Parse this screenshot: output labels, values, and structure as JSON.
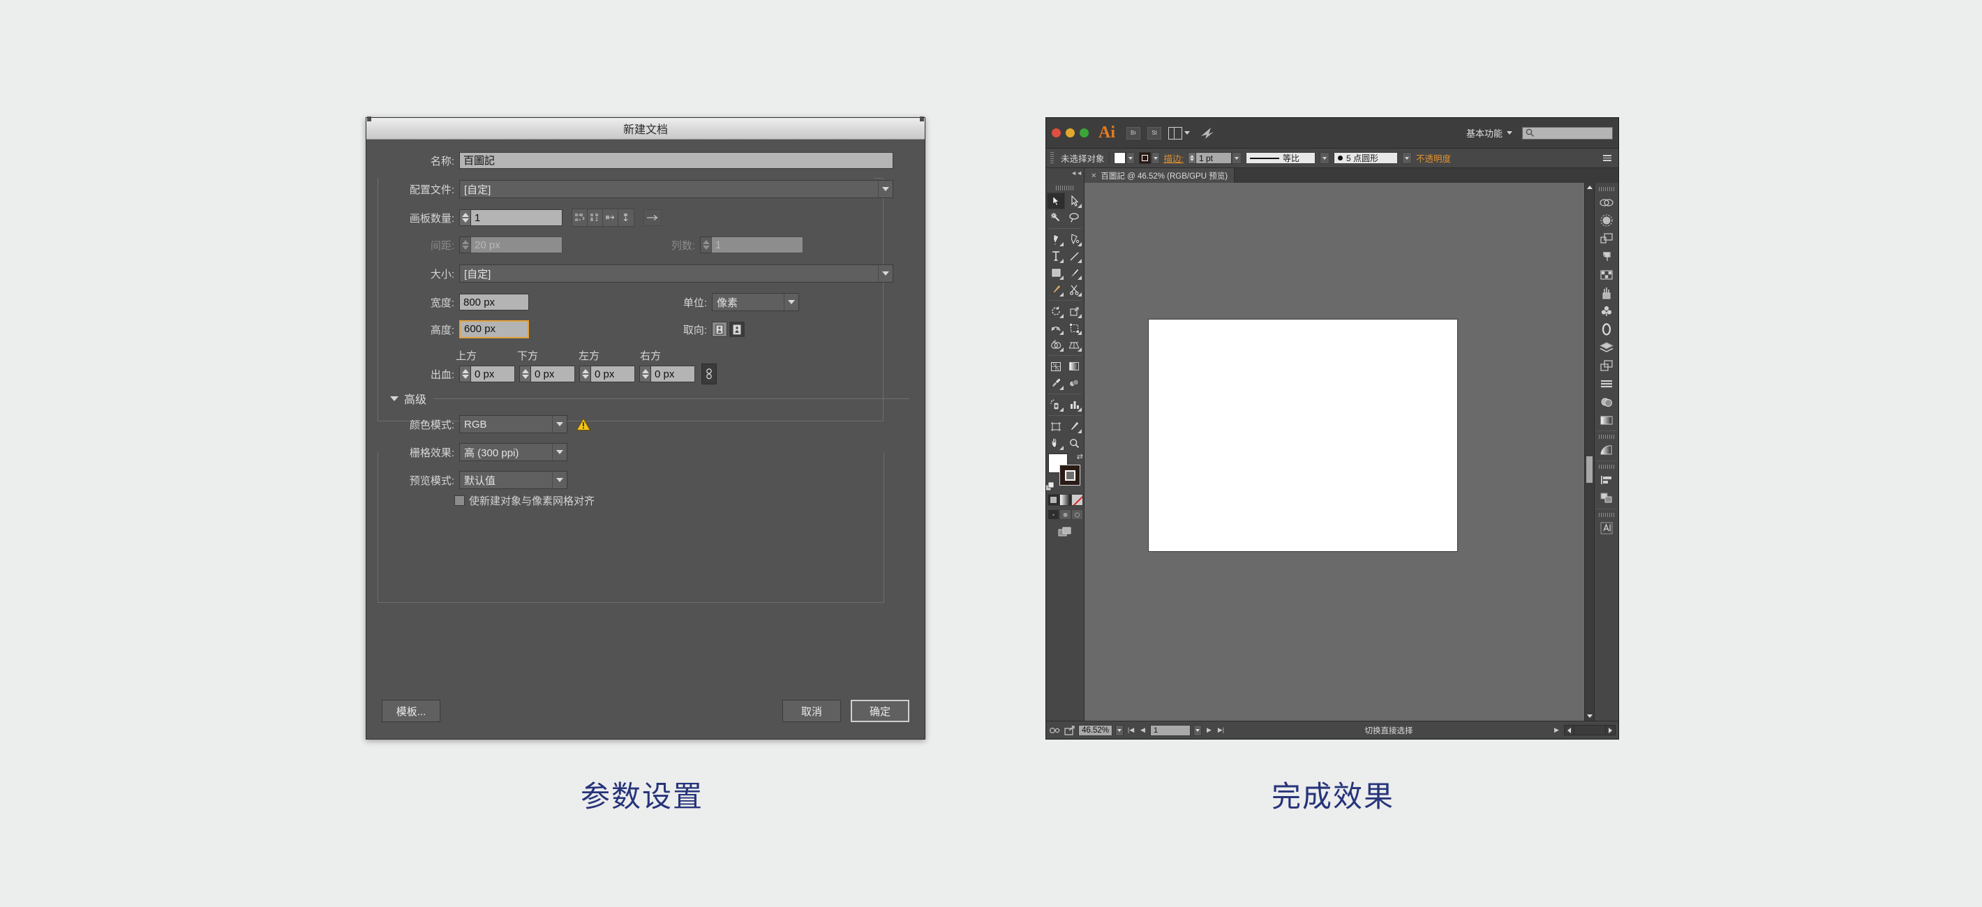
{
  "captions": {
    "left": "参数设置",
    "right": "完成效果",
    "color": "#26347a"
  },
  "dialog": {
    "title": "新建文档",
    "fields": {
      "name_label": "名称:",
      "name_value": "百圖記",
      "profile_label": "配置文件:",
      "profile_value": "[自定]",
      "artboards_label": "画板数量:",
      "artboards_value": "1",
      "spacing_label": "间距:",
      "spacing_value": "20 px",
      "columns_label": "列数:",
      "columns_value": "1",
      "size_label": "大小:",
      "size_value": "[自定]",
      "width_label": "宽度:",
      "width_value": "800 px",
      "units_label": "单位:",
      "units_value": "像素",
      "height_label": "高度:",
      "height_value": "600 px",
      "orientation_label": "取向:",
      "bleed_label": "出血:",
      "bleed_top_header": "上方",
      "bleed_bottom_header": "下方",
      "bleed_left_header": "左方",
      "bleed_right_header": "右方",
      "bleed_top": "0 px",
      "bleed_bottom": "0 px",
      "bleed_left": "0 px",
      "bleed_right": "0 px"
    },
    "advanced": {
      "section_label": "高级",
      "color_mode_label": "颜色模式:",
      "color_mode_value": "RGB",
      "raster_label": "栅格效果:",
      "raster_value": "高 (300 ppi)",
      "preview_label": "预览模式:",
      "preview_value": "默认值",
      "align_pixel_label": "使新建对象与像素网格对齐",
      "align_pixel_checked": false
    },
    "buttons": {
      "templates": "模板...",
      "cancel": "取消",
      "ok": "确定"
    },
    "focus_field": "height",
    "focus_color": "#e2a13c"
  },
  "illustrator": {
    "app_bar": {
      "logo": "Ai",
      "bridge_label": "Br",
      "stock_label": "St",
      "workspace": "基本功能",
      "search_placeholder": ""
    },
    "control_bar": {
      "selection_status": "未选择对象",
      "stroke_label": "描边:",
      "stroke_weight": "1 pt",
      "profile_value": "等比",
      "brush_value": "5 点圆形",
      "opacity_label": "不透明度",
      "accent_color": "#e0912f"
    },
    "document_tab": {
      "title": "百圖記 @ 46.52% (RGB/GPU 预览)"
    },
    "status_bar": {
      "zoom": "46.52%",
      "page": "1",
      "message": "切换直接选择"
    },
    "canvas": {
      "background_color": "#6a6a6a",
      "artboard_color": "#ffffff",
      "artboard_width": "800 px",
      "artboard_height": "600 px"
    },
    "tools": [
      {
        "name": "selection-tool",
        "selected": true
      },
      {
        "name": "direct-selection-tool",
        "selected": false
      },
      {
        "name": "magic-wand-tool",
        "selected": false
      },
      {
        "name": "lasso-tool",
        "selected": false
      },
      {
        "name": "pen-tool",
        "selected": false
      },
      {
        "name": "curvature-tool",
        "selected": false
      },
      {
        "name": "type-tool",
        "selected": false
      },
      {
        "name": "line-segment-tool",
        "selected": false
      },
      {
        "name": "rectangle-tool",
        "selected": false
      },
      {
        "name": "paintbrush-tool",
        "selected": false
      },
      {
        "name": "pencil-tool",
        "selected": false
      },
      {
        "name": "scissors-tool",
        "selected": false
      },
      {
        "name": "rotate-tool",
        "selected": false
      },
      {
        "name": "scale-tool",
        "selected": false
      },
      {
        "name": "width-tool",
        "selected": false
      },
      {
        "name": "free-transform-tool",
        "selected": false
      },
      {
        "name": "shape-builder-tool",
        "selected": false
      },
      {
        "name": "perspective-grid-tool",
        "selected": false
      },
      {
        "name": "mesh-tool",
        "selected": false
      },
      {
        "name": "gradient-tool",
        "selected": false
      },
      {
        "name": "eyedropper-tool",
        "selected": false
      },
      {
        "name": "blend-tool",
        "selected": false
      },
      {
        "name": "symbol-sprayer-tool",
        "selected": false
      },
      {
        "name": "column-graph-tool",
        "selected": false
      },
      {
        "name": "artboard-tool",
        "selected": false
      },
      {
        "name": "slice-tool",
        "selected": false
      },
      {
        "name": "hand-tool",
        "selected": false
      },
      {
        "name": "zoom-tool",
        "selected": false
      }
    ],
    "panel_icons": [
      {
        "name": "link-panel-icon"
      },
      {
        "name": "brushes-panel-icon"
      },
      {
        "name": "artboards-panel-icon"
      },
      {
        "name": "paragraph-panel-icon"
      },
      {
        "name": "swatches-panel-icon"
      },
      {
        "name": "brush-libraries-panel-icon"
      },
      {
        "name": "symbols-panel-icon"
      },
      {
        "name": "graphic-styles-panel-icon"
      },
      {
        "name": "layers-panel-icon"
      },
      {
        "name": "transparency-panel-icon"
      },
      {
        "name": "stroke-panel-icon"
      },
      {
        "name": "appearance-panel-icon"
      },
      {
        "name": "gradient-panel-icon"
      },
      {
        "name": "color-guide-panel-icon"
      },
      {
        "name": "align-panel-icon"
      },
      {
        "name": "pathfinder-panel-icon"
      },
      {
        "name": "character-panel-icon"
      }
    ]
  }
}
